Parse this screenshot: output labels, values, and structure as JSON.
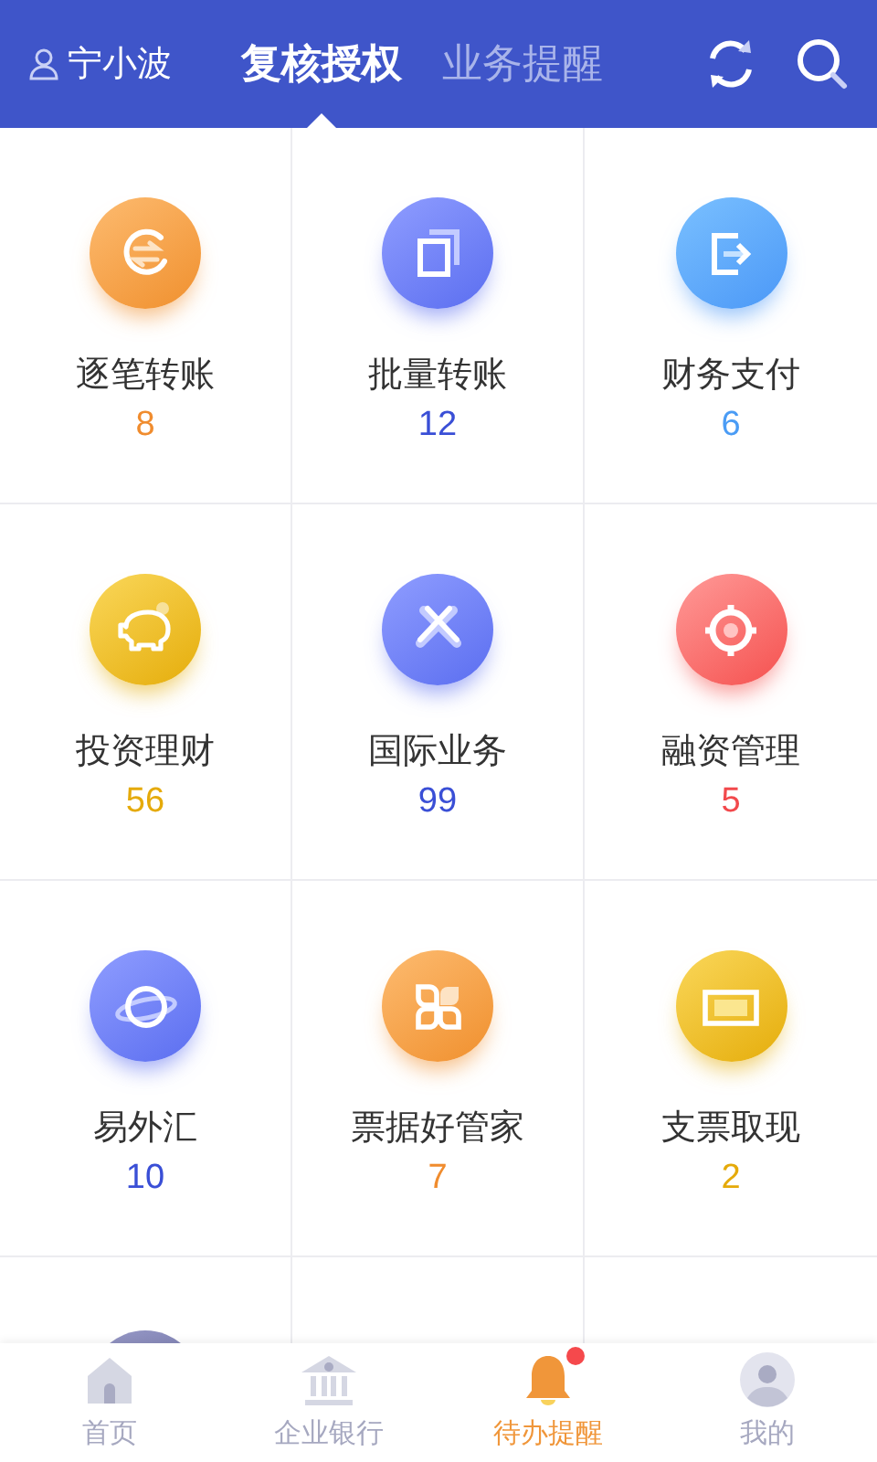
{
  "header": {
    "user": "宁小波",
    "tabs": [
      {
        "label": "复核授权",
        "selected": true
      },
      {
        "label": "业务提醒",
        "selected": false
      }
    ]
  },
  "tiles": [
    {
      "kind": "exchange",
      "label": "逐笔转账",
      "count": "8",
      "color": "#f08c2e"
    },
    {
      "kind": "copy",
      "label": "批量转账",
      "count": "12",
      "color": "#3a4fd6"
    },
    {
      "kind": "exit",
      "label": "财务支付",
      "count": "6",
      "color": "#4a9cf5"
    },
    {
      "kind": "piggy",
      "label": "投资理财",
      "count": "56",
      "color": "#e5aa0a"
    },
    {
      "kind": "link",
      "label": "国际业务",
      "count": "99",
      "color": "#3a4fd6"
    },
    {
      "kind": "target",
      "label": "融资管理",
      "count": "5",
      "color": "#f2494c"
    },
    {
      "kind": "planet",
      "label": "易外汇",
      "count": "10",
      "color": "#3a4fd6"
    },
    {
      "kind": "clover",
      "label": "票据好管家",
      "count": "7",
      "color": "#f08c2e"
    },
    {
      "kind": "note",
      "label": "支票取现",
      "count": "2",
      "color": "#e5aa0a"
    }
  ],
  "partial_tiles": [
    {
      "kind": "circle"
    },
    {
      "kind": "empty"
    },
    {
      "kind": "empty"
    }
  ],
  "tabbar": [
    {
      "kind": "home",
      "label": "首页",
      "selected": false,
      "badge": false
    },
    {
      "kind": "bank",
      "label": "企业银行",
      "selected": false,
      "badge": false
    },
    {
      "kind": "bell",
      "label": "待办提醒",
      "selected": true,
      "badge": true
    },
    {
      "kind": "person",
      "label": "我的",
      "selected": false,
      "badge": false
    }
  ]
}
